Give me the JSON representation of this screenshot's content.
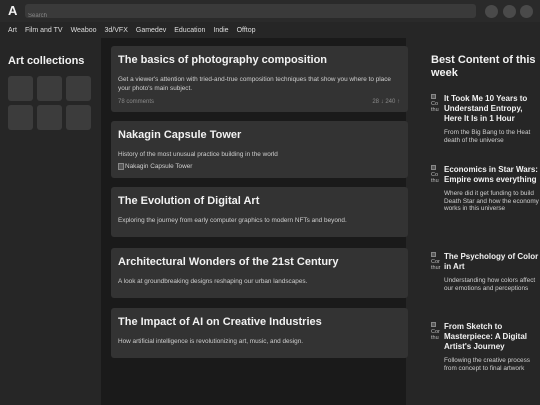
{
  "header": {
    "logo": "A",
    "search_placeholder": "Search"
  },
  "nav": [
    "Art",
    "Film and TV",
    "Weaboo",
    "3d/VFX",
    "Gamedev",
    "Education",
    "Indie",
    "Offtop"
  ],
  "left": {
    "title": "Art collections",
    "thumb_count": 6
  },
  "feed": [
    {
      "title": "The basics of photography composition",
      "desc": "Get a viewer's attention with tried-and-true composition techniques that show you where to place your photo's main subject.",
      "comments": "78 comments",
      "votes": "28 ↓ 240 ↑"
    },
    {
      "title": "Nakagin Capsule Tower",
      "desc": "History of the most unusual practice building in the world",
      "image_alt": "Nakagin Capsule Tower"
    },
    {
      "title": "The Evolution of Digital Art",
      "desc": "Exploring the journey from early computer graphics to modern NFTs and beyond."
    },
    {
      "title": "Architectural Wonders of the 21st Century",
      "desc": "A look at groundbreaking designs reshaping our urban landscapes."
    },
    {
      "title": "The Impact of AI on Creative Industries",
      "desc": "How artificial intelligence is revolutionizing art, music, and design."
    }
  ],
  "best": {
    "title": "Best Content of this week",
    "items": [
      {
        "thumb_alt": "Co thu",
        "title": "It Took Me 10 Years to Understand Entropy, Here It Is in 1 Hour",
        "desc": "From the Big Bang to the Heat death of the universe"
      },
      {
        "thumb_alt": "Co thu",
        "title": "Economics in Star Wars: Empire owns everything",
        "desc": "Where did it get funding to build Death Star and how the economy works in this universe"
      },
      {
        "thumb_alt": "Cor thur",
        "title": "The Psychology of Color in Art",
        "desc": "Understanding how colors affect our emotions and perceptions"
      },
      {
        "thumb_alt": "Cor thu",
        "title": "From Sketch to Masterpiece: A Digital Artist's Journey",
        "desc": "Following the creative process from concept to final artwork"
      }
    ]
  }
}
